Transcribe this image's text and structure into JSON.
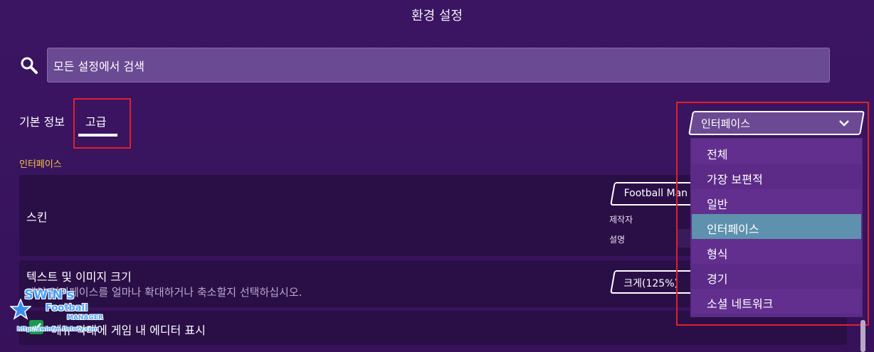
{
  "window": {
    "title": "환경 설정"
  },
  "search": {
    "placeholder": "모든 설정에서 검색"
  },
  "tabs": [
    {
      "label": "기본 정보",
      "active": false
    },
    {
      "label": "고급",
      "active": true
    }
  ],
  "section": {
    "label": "인터페이스"
  },
  "skin": {
    "label": "스킨",
    "value": "Football Man",
    "maker_label": "제작자",
    "desc_label": "설명"
  },
  "text_size": {
    "label": "텍스트 및 이미지 크기",
    "description": "게임 인터페이스를 얼마나 확대하거나 축소할지 선택하십시오.",
    "value": "크게(125%)"
  },
  "editor": {
    "label": "메뉴 막대에 게임 내 에디터 표시",
    "checked": true
  },
  "dropdown": {
    "selected": "인터페이스",
    "options": [
      "전체",
      "가장 보편적",
      "일반",
      "인터페이스",
      "형식",
      "경기",
      "소셜 네트워크"
    ]
  },
  "watermark": {
    "line1": "SWiN's",
    "line2": "Football",
    "line3": "MANAGER",
    "line4": "http://swinfm.tistory.com"
  },
  "colors": {
    "background": "#3a1560",
    "section_accent": "#f5c542",
    "selected_item": "#5e91ad",
    "annotation": "#e0202a",
    "checkbox": "#1a9b4a"
  }
}
